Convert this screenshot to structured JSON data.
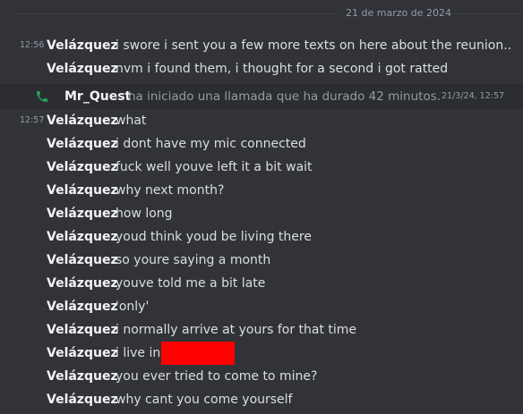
{
  "date_divider": "21 de marzo de 2024",
  "messages": [
    {
      "timestamp": "12:56",
      "author": "Velázquez",
      "text": "i swore i sent you a few more texts on here about the reunion.."
    },
    {
      "timestamp": "",
      "author": "Velázquez",
      "text": "nvm i found them, i thought for a second i got ratted"
    }
  ],
  "call": {
    "icon": "phone-icon",
    "icon_color": "#23a55a",
    "author": "Mr_Quest",
    "text": "ha iniciado una llamada que ha durado 42 minutos.",
    "timestamp": "21/3/24, 12:57"
  },
  "messages2": [
    {
      "timestamp": "12:57",
      "author": "Velázquez",
      "text": "what"
    },
    {
      "timestamp": "",
      "author": "Velázquez",
      "text": "i dont have my mic connected"
    },
    {
      "timestamp": "",
      "author": "Velázquez",
      "text": "fuck well youve left it a bit wait"
    },
    {
      "timestamp": "",
      "author": "Velázquez",
      "text": "why next month?"
    },
    {
      "timestamp": "",
      "author": "Velázquez",
      "text": "how long"
    },
    {
      "timestamp": "",
      "author": "Velázquez",
      "text": "youd think youd be living there"
    },
    {
      "timestamp": "",
      "author": "Velázquez",
      "text": "so youre saying a month"
    },
    {
      "timestamp": "",
      "author": "Velázquez",
      "text": "youve told me a bit late"
    },
    {
      "timestamp": "",
      "author": "Velázquez",
      "text": "'only'"
    },
    {
      "timestamp": "",
      "author": "Velázquez",
      "text": "i normally arrive at yours for that time"
    },
    {
      "timestamp": "",
      "author": "Velázquez",
      "text": "i live in",
      "redacted": true
    },
    {
      "timestamp": "",
      "author": "Velázquez",
      "text": "you ever tried to come to mine?"
    },
    {
      "timestamp": "",
      "author": "Velázquez",
      "text": "why cant you come yourself"
    }
  ]
}
